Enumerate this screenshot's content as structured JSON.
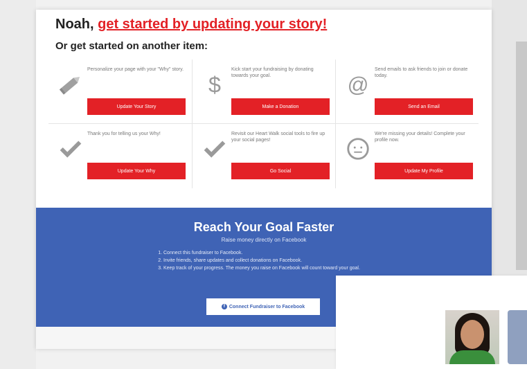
{
  "header": {
    "name_prefix": "Noah,",
    "cta_link": "get started by updating your story!",
    "subtitle": "Or get started on another item:"
  },
  "items": [
    {
      "icon": "pencil-icon",
      "desc": "Personalize your page with your \"Why\" story.",
      "button": "Update Your Story"
    },
    {
      "icon": "dollar-icon",
      "desc": "Kick start your fundraising by donating towards your goal.",
      "button": "Make a Donation"
    },
    {
      "icon": "at-sign-icon",
      "desc": "Send emails to ask friends to join or donate today.",
      "button": "Send an Email"
    },
    {
      "icon": "checkmark-icon",
      "desc": "Thank you for telling us your Why!",
      "button": "Update Your Why"
    },
    {
      "icon": "checkmark-icon",
      "desc": "Revisit our Heart Walk social tools to fire up your social pages!",
      "button": "Go Social"
    },
    {
      "icon": "smiley-icon",
      "desc": "We're missing your details! Complete your profile now.",
      "button": "Update My Profile"
    }
  ],
  "facebook": {
    "title": "Reach Your Goal Faster",
    "subtitle": "Raise money directly on Facebook",
    "steps": [
      "Connect this fundraiser to Facebook.",
      "Invite friends, share updates and collect donations on Facebook.",
      "Keep track of your progress. The money you raise on Facebook will count toward your goal."
    ],
    "button": "Connect Fundraiser to Facebook"
  },
  "colors": {
    "accent_red": "#e32126",
    "facebook_blue": "#3f63b5"
  }
}
